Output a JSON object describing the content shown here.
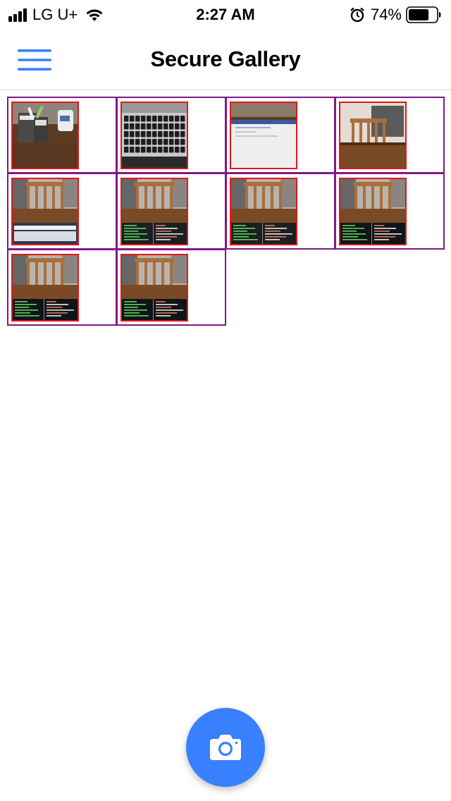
{
  "status_bar": {
    "carrier": "LG U+",
    "time": "2:27 AM",
    "battery_percent": "74%",
    "battery_level": 0.74,
    "icons": [
      "signal-icon",
      "wifi-icon",
      "alarm-icon",
      "battery-icon"
    ]
  },
  "header": {
    "title": "Secure Gallery",
    "menu_icon": "hamburger-menu-icon",
    "accent_color": "#3880ff"
  },
  "gallery": {
    "cell_border_color": "#7f1a84",
    "image_border_color": "#e01818",
    "photos": [
      {
        "scene": "desk-with-mugs"
      },
      {
        "scene": "laptop-keyboard"
      },
      {
        "scene": "laptop-screen-browser"
      },
      {
        "scene": "chair-and-table"
      },
      {
        "scene": "chair-and-laptop"
      },
      {
        "scene": "chair-and-terminal"
      },
      {
        "scene": "chair-and-terminal"
      },
      {
        "scene": "chair-and-terminal-dark"
      },
      {
        "scene": "chair-and-terminal-dark"
      },
      {
        "scene": "chair-and-terminal-dark"
      }
    ]
  },
  "fab": {
    "icon": "camera-icon",
    "color": "#3880ff"
  }
}
